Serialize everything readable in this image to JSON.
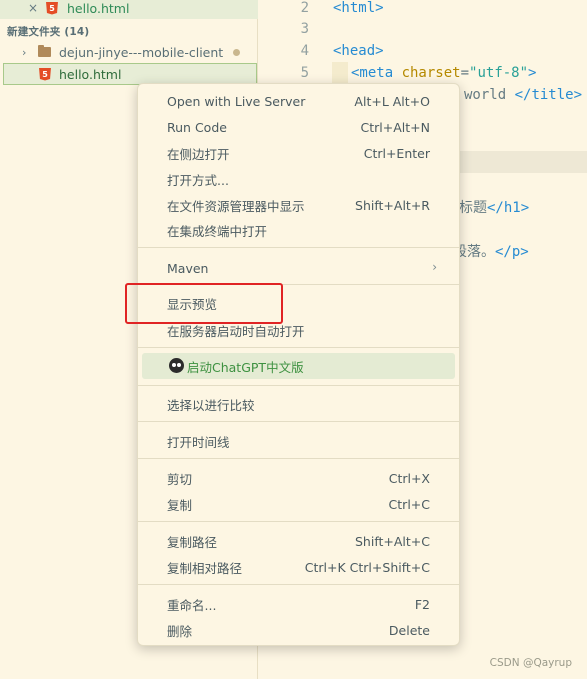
{
  "explorer": {
    "open_file": {
      "name": "hello.html",
      "close": "×",
      "icon": "5"
    },
    "section_title": "新建文件夹 (14)",
    "folder": {
      "name": "dejun-jinye---mobile-client",
      "chevron": "›"
    },
    "file": {
      "name": "hello.html",
      "icon": "5"
    }
  },
  "editor": {
    "line_numbers": [
      "2",
      "3",
      "4",
      "5"
    ],
    "lines": {
      "l2": "<html>",
      "l4": "<head>",
      "l5_tag_open": "<meta ",
      "l5_attr": "charset",
      "l5_eq": "=",
      "l5_val": "\"utf-8\"",
      "l5_close": ">",
      "frag_title_text": "world",
      "frag_title_tag": "</title>",
      "frag_h1_text": "标题",
      "frag_h1_tag": "</h1>",
      "frag_p_text": "段落。",
      "frag_p_tag": "</p>"
    }
  },
  "context_menu": {
    "groups": [
      [
        {
          "label": "Open with Live Server",
          "shortcut": "Alt+L Alt+O"
        },
        {
          "label": "Run Code",
          "shortcut": "Ctrl+Alt+N"
        },
        {
          "label": "在侧边打开",
          "shortcut": "Ctrl+Enter"
        },
        {
          "label": "打开方式...",
          "shortcut": ""
        },
        {
          "label": "在文件资源管理器中显示",
          "shortcut": "Shift+Alt+R"
        },
        {
          "label": "在集成终端中打开",
          "shortcut": ""
        }
      ],
      [
        {
          "label": "Maven",
          "submenu": "›"
        }
      ],
      [
        {
          "label": "显示预览",
          "shortcut": ""
        },
        {
          "label": "在服务器启动时自动打开",
          "shortcut": ""
        }
      ],
      [
        {
          "label": "启动ChatGPT中文版",
          "icon": "robot-icon"
        }
      ],
      [
        {
          "label": "选择以进行比较",
          "shortcut": ""
        }
      ],
      [
        {
          "label": "打开时间线",
          "shortcut": ""
        }
      ],
      [
        {
          "label": "剪切",
          "shortcut": "Ctrl+X"
        },
        {
          "label": "复制",
          "shortcut": "Ctrl+C"
        }
      ],
      [
        {
          "label": "复制路径",
          "shortcut": "Shift+Alt+C"
        },
        {
          "label": "复制相对路径",
          "shortcut": "Ctrl+K Ctrl+Shift+C"
        }
      ],
      [
        {
          "label": "重命名...",
          "shortcut": "F2"
        },
        {
          "label": "删除",
          "shortcut": "Delete"
        }
      ]
    ]
  },
  "watermark": "CSDN @Qayrup",
  "colors": {
    "background": "#fdf6e3",
    "highlight_box": "#e02424",
    "chatgpt_text": "#3d9140"
  }
}
